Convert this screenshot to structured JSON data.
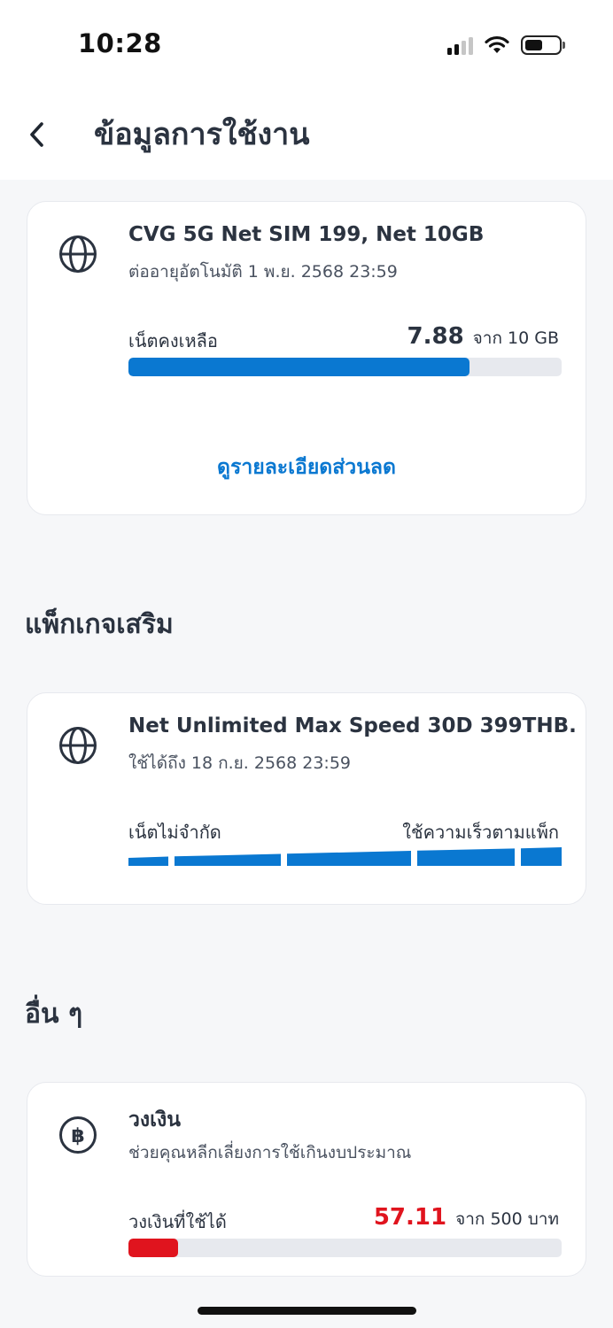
{
  "status_bar": {
    "time": "10:28"
  },
  "header": {
    "title": "ข้อมูลการใช้งาน"
  },
  "main_package": {
    "icon": "globe-icon",
    "name": "CVG 5G Net SIM 199, Net 10GB",
    "renewal": "ต่ออายุอัตโนมัติ 1 พ.ย. 2568 23:59",
    "remaining_label": "เน็ตคงเหลือ",
    "remaining_value": "7.88",
    "remaining_of": "จาก 10 GB",
    "remaining_fraction": 0.788,
    "link_label": "ดูรายละเอียดส่วนลด",
    "accent_color": "#0a78d1"
  },
  "addons_section": {
    "heading": "แพ็กเกจเสริม"
  },
  "addon_package": {
    "icon": "globe-icon",
    "name": "Net Unlimited Max Speed 30D 399THB.",
    "valid_until": "ใช้ได้ถึง 18 ก.ย. 2568 23:59",
    "left_label": "เน็ตไม่จำกัด",
    "right_label": "ใช้ความเร็วตามแพ็ก"
  },
  "others_section": {
    "heading": "อื่น ๆ"
  },
  "credit_limit": {
    "icon": "baht-icon",
    "title": "วงเงิน",
    "description": "ช่วยคุณหลีกเลี่ยงการใช้เกินงบประมาณ",
    "available_label": "วงเงินที่ใช้ได้",
    "available_value": "57.11",
    "available_of": "จาก 500 บาท",
    "available_fraction": 0.1142,
    "alert_color": "#e0141e"
  }
}
